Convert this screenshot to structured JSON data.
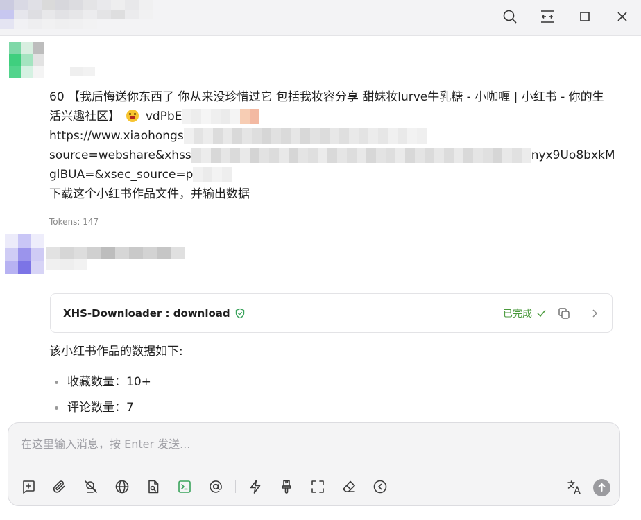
{
  "window": {
    "controls": [
      "search-icon",
      "fit-width-icon",
      "maximize-icon",
      "close-icon"
    ]
  },
  "user_message": {
    "line1": "60 【我后悔送你东西了 你从来没珍惜过它 包括我妆容分享 甜妹妆lurve牛乳糖 - 小咖喱 | 小红书 - 你的生",
    "line2_prefix": "活兴趣社区】",
    "line2_suffix": "vdPbE",
    "line3_prefix": "https://www.xiaohongs",
    "line4_prefix": "source=webshare&xhss",
    "line4_suffix": "nyx9Uo8bxkM",
    "line5_prefix": "glBUA=&xsec_source=p",
    "line6": "下载这个小红书作品文件，并输出数据",
    "tokens": "Tokens: 147"
  },
  "tool_call": {
    "name": "XHS-Downloader : download",
    "status": "已完成",
    "colors": {
      "status": "#4a9a3c",
      "shield": "#3aa35c"
    }
  },
  "assistant_reply": {
    "intro": "该小红书作品的数据如下:",
    "items": [
      {
        "label": "收藏数量：10+"
      },
      {
        "label": "评论数量：7"
      }
    ]
  },
  "composer": {
    "placeholder": "在这里输入消息，按 Enter 发送...",
    "toolbar_icons": [
      "new-topic-icon",
      "attachment-icon",
      "web-search-off-icon",
      "globe-icon",
      "knowledge-file-icon",
      "terminal-icon",
      "mention-icon",
      "lightning-icon",
      "brush-icon",
      "expand-icon",
      "eraser-icon",
      "collapse-left-icon"
    ],
    "active_tool": "terminal-icon",
    "translate_icon": "translate-icon",
    "send_icon": "send-arrow-icon"
  }
}
